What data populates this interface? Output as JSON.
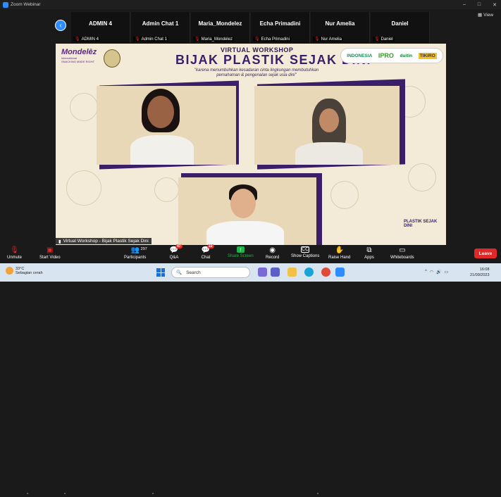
{
  "window": {
    "title": "Zoom Webinar",
    "controls": [
      "–",
      "□",
      "✕"
    ]
  },
  "view_button": {
    "label": "View"
  },
  "participants_strip": [
    {
      "name": "ADMIN 4",
      "tag": "ADMIN 4"
    },
    {
      "name": "Admin Chat 1",
      "tag": "Admin Chat 1"
    },
    {
      "name": "Maria_Mondelez",
      "tag": "Maria_Mondelez"
    },
    {
      "name": "Echa Primadini",
      "tag": "Echa Primadini"
    },
    {
      "name": "Nur Amelia",
      "tag": "Nur Amelia"
    },
    {
      "name": "Daniel",
      "tag": "Daniel"
    }
  ],
  "slide": {
    "subheading": "VIRTUAL WORKSHOP",
    "title": "BIJAK PLASTIK SEJAK DINI",
    "quote": "\"karena menumbuhkan kesadaran cinta lingkungan membutuhkan pemahaman & pengenalan sejak usia dini\"",
    "left_logo": {
      "brand": "Mondelēz",
      "line1": "International",
      "line2": "SNACKING MADE RIGHT"
    },
    "sponsors": [
      "INDONESIA",
      "IPRO",
      "duitin",
      "TIKIRO"
    ],
    "corner_brand": "PLASTIK SEJAK DINI",
    "accent_color": "#3a1e6a"
  },
  "caption": {
    "text": "Virtual Workshop - Bijak Plastik Sejak Dini"
  },
  "toolbar": {
    "unmute": "Unmute",
    "start_video": "Start Video",
    "participants": "Participants",
    "participants_count": "297",
    "qa": "Q&A",
    "qa_badge": "47",
    "chat": "Chat",
    "chat_badge": "22",
    "share_screen": "Share Screen",
    "record": "Record",
    "captions": "Show Captions",
    "raise_hand": "Raise Hand",
    "apps": "Apps",
    "whiteboards": "Whiteboards",
    "leave": "Leave"
  },
  "taskbar": {
    "temperature": "33°C",
    "weather": "Sebagian cerah",
    "search_placeholder": "Search",
    "time": "16:08",
    "date": "21/09/2023"
  }
}
